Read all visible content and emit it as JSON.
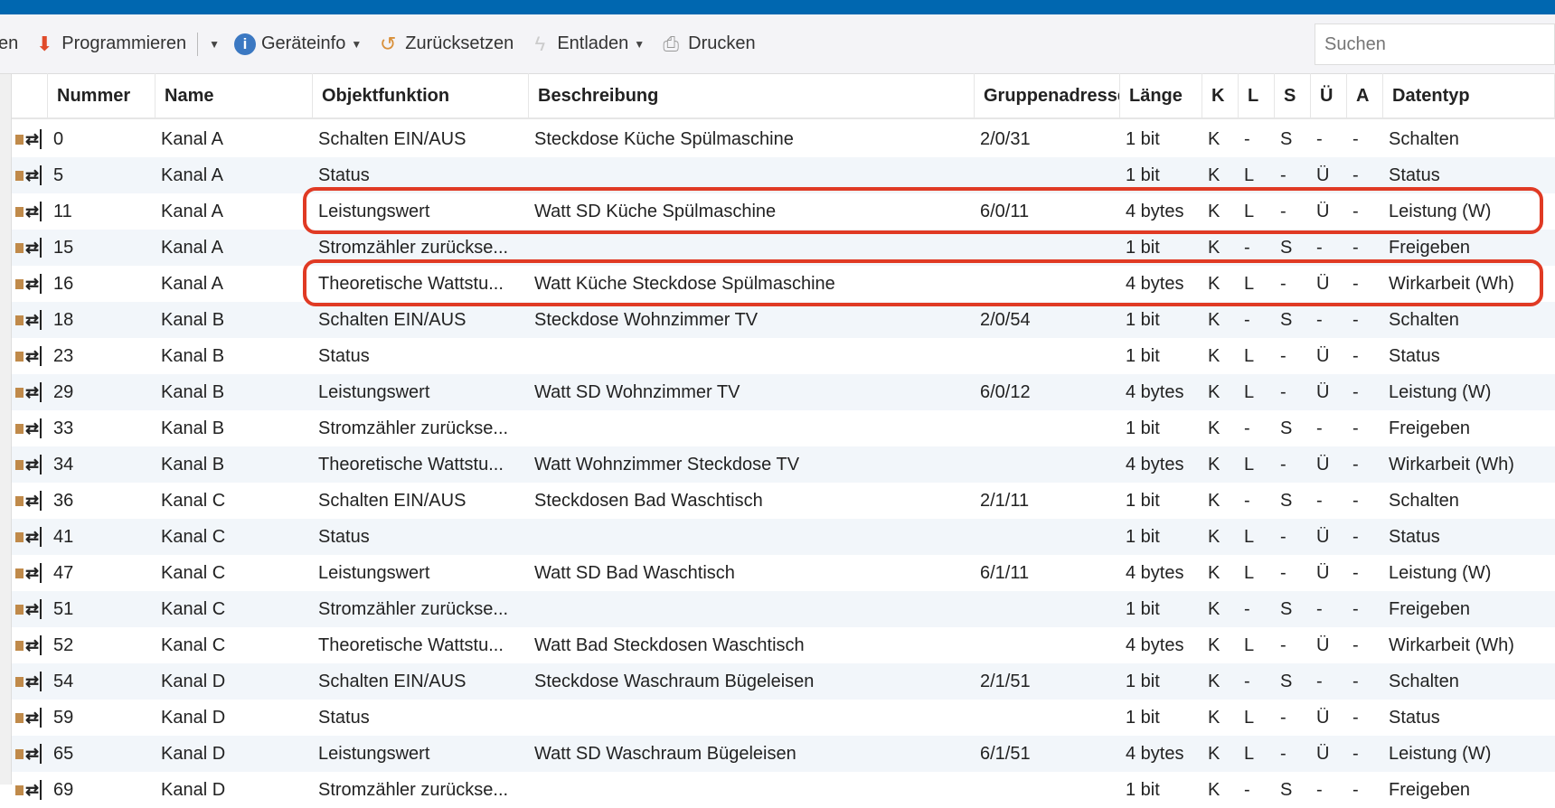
{
  "toolbar": {
    "items": [
      {
        "label": "en",
        "icon": "none"
      },
      {
        "label": "Programmieren",
        "icon": "download-arrow-icon",
        "dropdown": true
      },
      {
        "label": "Geräteinfo",
        "icon": "info-icon",
        "dropdown": true
      },
      {
        "label": "Zurücksetzen",
        "icon": "reset-icon"
      },
      {
        "label": "Entladen",
        "icon": "lightning-icon",
        "dropdown": true
      },
      {
        "label": "Drucken",
        "icon": "printer-icon"
      }
    ],
    "search_placeholder": "Suchen"
  },
  "columns": [
    "",
    "Nummer",
    "Name",
    "Objektfunktion",
    "Beschreibung",
    "Gruppenadresse",
    "Länge",
    "K",
    "L",
    "S",
    "Ü",
    "A",
    "Datentyp"
  ],
  "rows": [
    [
      "0",
      "Kanal A",
      "Schalten EIN/AUS",
      "Steckdose Küche Spülmaschine",
      "2/0/31",
      "1 bit",
      "K",
      "-",
      "S",
      "-",
      "-",
      "Schalten"
    ],
    [
      "5",
      "Kanal A",
      "Status",
      "",
      "",
      "1 bit",
      "K",
      "L",
      "-",
      "Ü",
      "-",
      "Status"
    ],
    [
      "11",
      "Kanal A",
      "Leistungswert",
      "Watt SD Küche Spülmaschine",
      "6/0/11",
      "4 bytes",
      "K",
      "L",
      "-",
      "Ü",
      "-",
      "Leistung (W)"
    ],
    [
      "15",
      "Kanal A",
      "Stromzähler zurückse...",
      "",
      "",
      "1 bit",
      "K",
      "-",
      "S",
      "-",
      "-",
      "Freigeben"
    ],
    [
      "16",
      "Kanal A",
      "Theoretische Wattstu...",
      "Watt Küche Steckdose Spülmaschine",
      "",
      "4 bytes",
      "K",
      "L",
      "-",
      "Ü",
      "-",
      "Wirkarbeit (Wh)"
    ],
    [
      "18",
      "Kanal B",
      "Schalten EIN/AUS",
      "Steckdose Wohnzimmer TV",
      "2/0/54",
      "1 bit",
      "K",
      "-",
      "S",
      "-",
      "-",
      "Schalten"
    ],
    [
      "23",
      "Kanal B",
      "Status",
      "",
      "",
      "1 bit",
      "K",
      "L",
      "-",
      "Ü",
      "-",
      "Status"
    ],
    [
      "29",
      "Kanal B",
      "Leistungswert",
      "Watt SD Wohnzimmer TV",
      "6/0/12",
      "4 bytes",
      "K",
      "L",
      "-",
      "Ü",
      "-",
      "Leistung (W)"
    ],
    [
      "33",
      "Kanal B",
      "Stromzähler zurückse...",
      "",
      "",
      "1 bit",
      "K",
      "-",
      "S",
      "-",
      "-",
      "Freigeben"
    ],
    [
      "34",
      "Kanal B",
      "Theoretische Wattstu...",
      "Watt Wohnzimmer Steckdose TV",
      "",
      "4 bytes",
      "K",
      "L",
      "-",
      "Ü",
      "-",
      "Wirkarbeit (Wh)"
    ],
    [
      "36",
      "Kanal C",
      "Schalten EIN/AUS",
      "Steckdosen Bad Waschtisch",
      "2/1/11",
      "1 bit",
      "K",
      "-",
      "S",
      "-",
      "-",
      "Schalten"
    ],
    [
      "41",
      "Kanal C",
      "Status",
      "",
      "",
      "1 bit",
      "K",
      "L",
      "-",
      "Ü",
      "-",
      "Status"
    ],
    [
      "47",
      "Kanal C",
      "Leistungswert",
      "Watt SD Bad Waschtisch",
      "6/1/11",
      "4 bytes",
      "K",
      "L",
      "-",
      "Ü",
      "-",
      "Leistung (W)"
    ],
    [
      "51",
      "Kanal C",
      "Stromzähler zurückse...",
      "",
      "",
      "1 bit",
      "K",
      "-",
      "S",
      "-",
      "-",
      "Freigeben"
    ],
    [
      "52",
      "Kanal C",
      "Theoretische Wattstu...",
      "Watt Bad Steckdosen Waschtisch",
      "",
      "4 bytes",
      "K",
      "L",
      "-",
      "Ü",
      "-",
      "Wirkarbeit (Wh)"
    ],
    [
      "54",
      "Kanal D",
      "Schalten EIN/AUS",
      "Steckdose Waschraum Bügeleisen",
      "2/1/51",
      "1 bit",
      "K",
      "-",
      "S",
      "-",
      "-",
      "Schalten"
    ],
    [
      "59",
      "Kanal D",
      "Status",
      "",
      "",
      "1 bit",
      "K",
      "L",
      "-",
      "Ü",
      "-",
      "Status"
    ],
    [
      "65",
      "Kanal D",
      "Leistungswert",
      "Watt SD Waschraum Bügeleisen",
      "6/1/51",
      "4 bytes",
      "K",
      "L",
      "-",
      "Ü",
      "-",
      "Leistung (W)"
    ],
    [
      "69",
      "Kanal D",
      "Stromzähler zurückse...",
      "",
      "",
      "1 bit",
      "K",
      "-",
      "S",
      "-",
      "-",
      "Freigeben"
    ]
  ],
  "highlighted_rows": [
    2,
    4
  ],
  "colors": {
    "highlight": "#e03a24",
    "titlebar": "#0067b0",
    "row_alt": "#f2f6fa"
  }
}
